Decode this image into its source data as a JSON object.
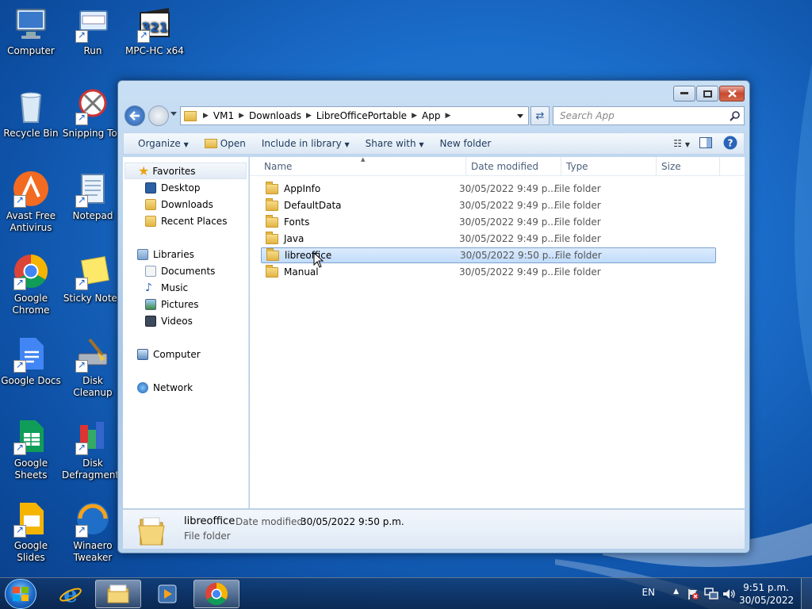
{
  "desktop": {
    "icons": [
      {
        "label": "Computer",
        "icon": "computer-icon"
      },
      {
        "label": "Run",
        "icon": "run-icon"
      },
      {
        "label": "MPC-HC x64",
        "icon": "mpc-hc-icon"
      },
      {
        "label": "Recycle Bin",
        "icon": "recycle-bin-icon"
      },
      {
        "label": "Snipping Too",
        "icon": "snipping-tool-icon"
      },
      {
        "label": "Avast Free Antivirus",
        "icon": "avast-icon"
      },
      {
        "label": "Notepad",
        "icon": "notepad-icon"
      },
      {
        "label": "Google Chrome",
        "icon": "chrome-icon"
      },
      {
        "label": "Sticky Notes",
        "icon": "sticky-notes-icon"
      },
      {
        "label": "Google Docs",
        "icon": "google-docs-icon"
      },
      {
        "label": "Disk Cleanup",
        "icon": "disk-cleanup-icon"
      },
      {
        "label": "Google Sheets",
        "icon": "google-sheets-icon"
      },
      {
        "label": "Disk Defragmenter",
        "icon": "disk-defrag-icon"
      },
      {
        "label": "Google Slides",
        "icon": "google-slides-icon"
      },
      {
        "label": "Winaero Tweaker",
        "icon": "winaero-icon"
      }
    ]
  },
  "explorer": {
    "breadcrumb": [
      "VM1",
      "Downloads",
      "LibreOfficePortable",
      "App"
    ],
    "search_placeholder": "Search App",
    "toolbar": {
      "organize": "Organize",
      "open": "Open",
      "include_in_library": "Include in library",
      "share_with": "Share with",
      "new_folder": "New folder"
    },
    "nav": {
      "favorites": {
        "label": "Favorites",
        "items": [
          "Desktop",
          "Downloads",
          "Recent Places"
        ]
      },
      "libraries": {
        "label": "Libraries",
        "items": [
          "Documents",
          "Music",
          "Pictures",
          "Videos"
        ]
      },
      "computer": "Computer",
      "network": "Network"
    },
    "columns": {
      "name": "Name",
      "date_modified": "Date modified",
      "type": "Type",
      "size": "Size"
    },
    "files": [
      {
        "name": "AppInfo",
        "date": "30/05/2022 9:49 p....",
        "type": "File folder",
        "selected": false
      },
      {
        "name": "DefaultData",
        "date": "30/05/2022 9:49 p....",
        "type": "File folder",
        "selected": false
      },
      {
        "name": "Fonts",
        "date": "30/05/2022 9:49 p....",
        "type": "File folder",
        "selected": false
      },
      {
        "name": "Java",
        "date": "30/05/2022 9:49 p....",
        "type": "File folder",
        "selected": false
      },
      {
        "name": "libreoffice",
        "date": "30/05/2022 9:50 p....",
        "type": "File folder",
        "selected": true
      },
      {
        "name": "Manual",
        "date": "30/05/2022 9:49 p....",
        "type": "File folder",
        "selected": false
      }
    ],
    "details": {
      "name": "libreoffice",
      "date_label": "Date modified:",
      "date_value": "30/05/2022 9:50 p.m.",
      "type": "File folder"
    }
  },
  "taskbar": {
    "language": "EN",
    "time": "9:51 p.m.",
    "date": "30/05/2022"
  }
}
